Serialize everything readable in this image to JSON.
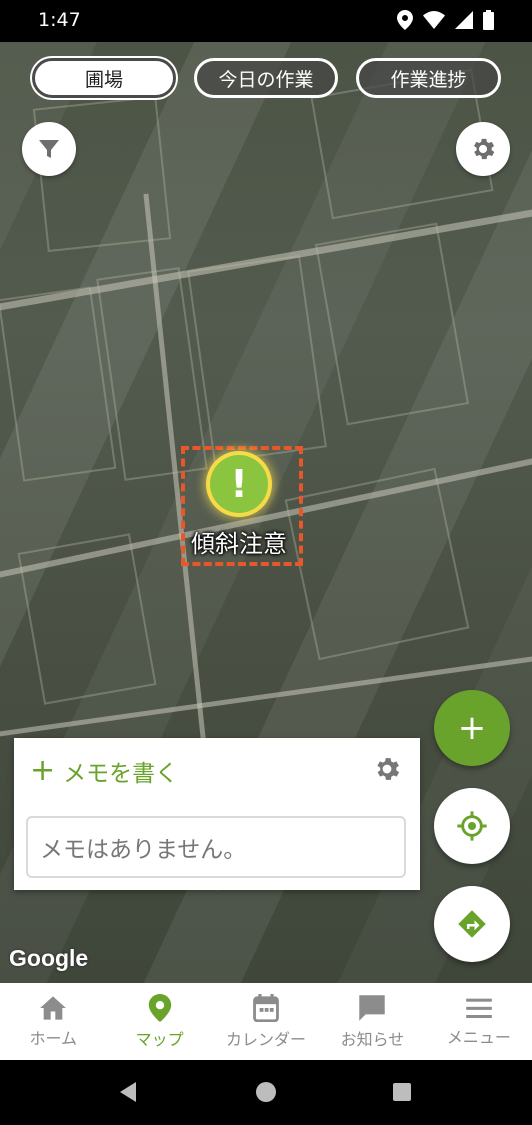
{
  "status_bar": {
    "time": "1:47"
  },
  "tabs": [
    {
      "label": "圃場",
      "active": true
    },
    {
      "label": "今日の作業",
      "active": false
    },
    {
      "label": "作業進捗",
      "active": false
    }
  ],
  "map": {
    "marker_label": "傾斜注意",
    "marker_glyph": "!",
    "attribution": "Google"
  },
  "memo": {
    "add_label": "メモを書く",
    "add_glyph": "+",
    "empty_text": "メモはありません。"
  },
  "fab": {
    "add_glyph": "+"
  },
  "bottom_nav": [
    {
      "label": "ホーム",
      "icon": "home-icon",
      "active": false
    },
    {
      "label": "マップ",
      "icon": "map-pin-icon",
      "active": true
    },
    {
      "label": "カレンダー",
      "icon": "calendar-icon",
      "active": false
    },
    {
      "label": "お知らせ",
      "icon": "message-icon",
      "active": false
    },
    {
      "label": "メニュー",
      "icon": "menu-icon",
      "active": false
    }
  ],
  "colors": {
    "accent": "#6aa32c",
    "marker": "#8bc43f",
    "highlight": "#e8572a"
  }
}
